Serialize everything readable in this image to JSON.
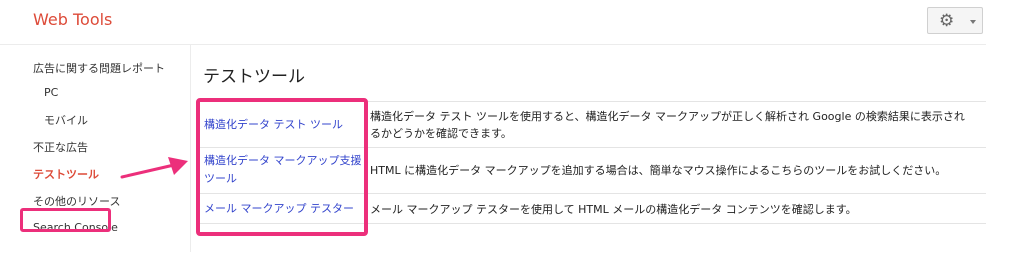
{
  "app": {
    "title": "Web Tools"
  },
  "header": {
    "settings_icon": "gear-icon",
    "dropdown_icon": "caret-down-icon"
  },
  "sidebar": {
    "items": [
      {
        "label": "広告に関する問題レポート"
      },
      {
        "label": "PC"
      },
      {
        "label": "モバイル"
      },
      {
        "label": "不正な広告"
      },
      {
        "label": "テストツール",
        "active": true
      },
      {
        "label": "その他のリソース"
      },
      {
        "label": "Search Console"
      }
    ]
  },
  "main": {
    "title": "テストツール",
    "tools": [
      {
        "name": "構造化データ テスト ツール",
        "description": "構造化データ テスト ツールを使用すると、構造化データ マークアップが正しく解析され Google の検索結果に表示されるかどうかを確認できます。"
      },
      {
        "name": "構造化データ マークアップ支援ツール",
        "description": "HTML に構造化データ マークアップを追加する場合は、簡単なマウス操作によるこちらのツールをお試しください。"
      },
      {
        "name": "メール マークアップ テスター",
        "description": "メール マークアップ テスターを使用して HTML メールの構造化データ コンテンツを確認します。"
      }
    ]
  },
  "colors": {
    "brand": "#dd4b39",
    "link": "#3344cc",
    "annotation": "#ec2f7b"
  }
}
